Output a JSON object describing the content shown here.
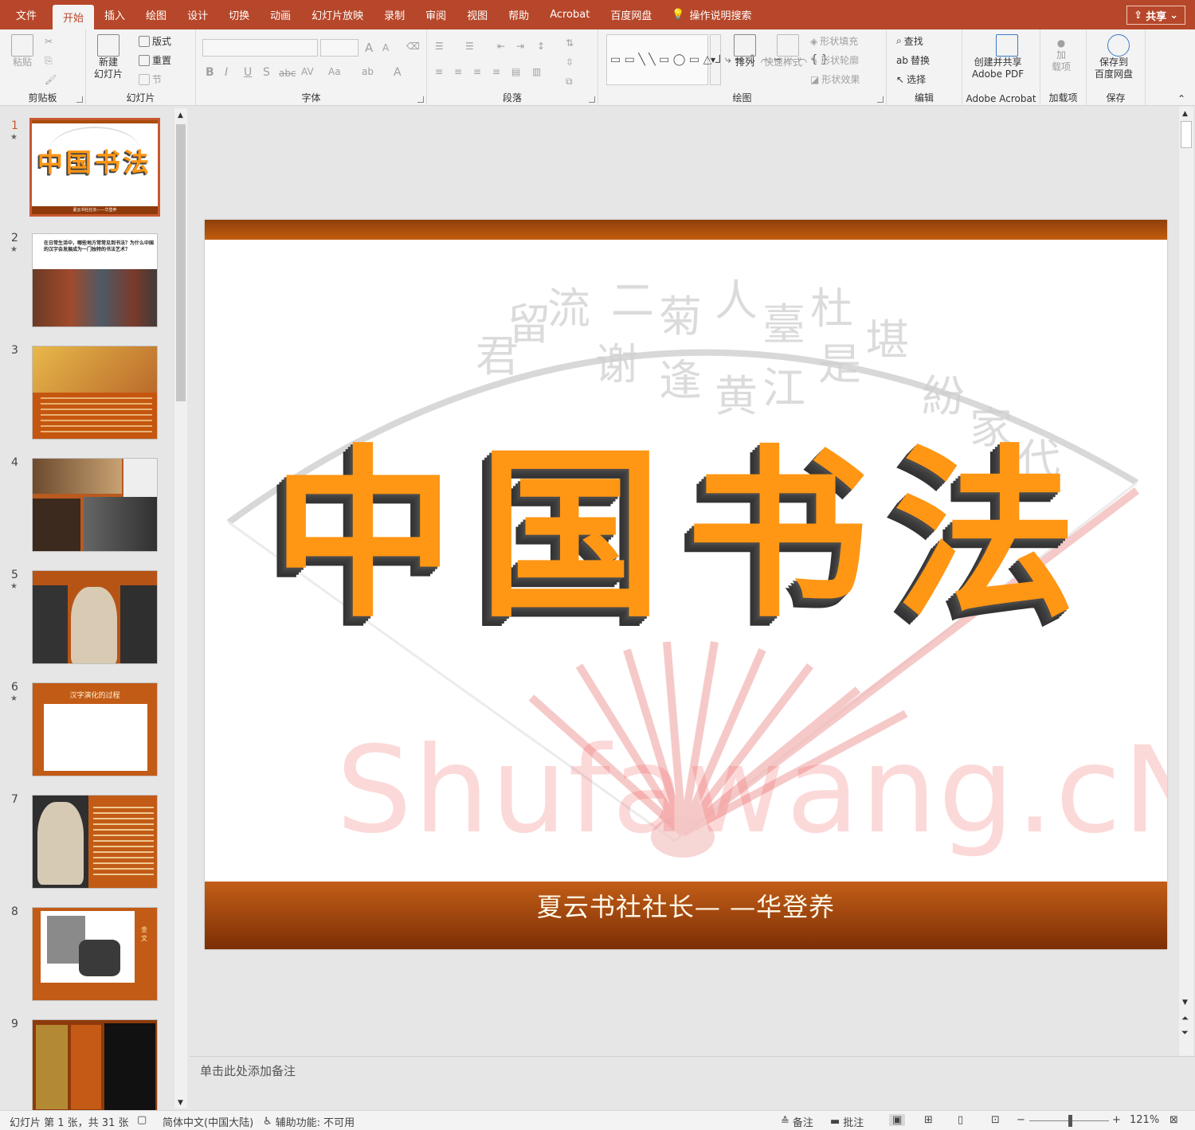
{
  "menu": {
    "tabs": [
      "文件",
      "开始",
      "插入",
      "绘图",
      "设计",
      "切换",
      "动画",
      "幻灯片放映",
      "录制",
      "审阅",
      "视图",
      "帮助",
      "Acrobat",
      "百度网盘"
    ],
    "active": "开始",
    "search": "操作说明搜索",
    "share": "共享"
  },
  "ribbon": {
    "clipboard": {
      "label": "剪贴板",
      "paste": "粘贴"
    },
    "slides": {
      "label": "幻灯片",
      "new_slide_1": "新建",
      "new_slide_2": "幻灯片",
      "layout": "版式",
      "reset": "重置",
      "section": "节"
    },
    "font": {
      "label": "字体",
      "bold": "B",
      "italic": "I",
      "underline": "U",
      "shadow": "S",
      "strike": "abc",
      "spacing": "AV",
      "case": "Aa",
      "grow": "A",
      "shrink": "A"
    },
    "paragraph": {
      "label": "段落"
    },
    "drawing": {
      "label": "绘图",
      "arrange": "排列",
      "quick_styles": "快速样式",
      "shape_fill": "形状填充",
      "shape_outline": "形状轮廓",
      "shape_effects": "形状效果"
    },
    "editing": {
      "label": "编辑",
      "find": "查找",
      "replace": "替换",
      "select": "选择"
    },
    "acrobat": {
      "label": "Adobe Acrobat",
      "create_1": "创建并共享",
      "create_2": "Adobe PDF"
    },
    "addins": {
      "label": "加载项",
      "btn_1": "加",
      "btn_2": "载项"
    },
    "save": {
      "label": "保存",
      "btn_1": "保存到",
      "btn_2": "百度网盘"
    }
  },
  "thumbnails": [
    {
      "num": "1",
      "star": true,
      "selected": true,
      "title": "中国书法",
      "subtitle": "夏云书社社长——华登养"
    },
    {
      "num": "2",
      "star": true,
      "caption": "在日常生活中，哪些地方常常见到书法？为什么中国的汉字会发展成为一门独特的书法艺术？"
    },
    {
      "num": "3",
      "star": false
    },
    {
      "num": "4",
      "star": false
    },
    {
      "num": "5",
      "star": true
    },
    {
      "num": "6",
      "star": true,
      "caption": "汉字演化的过程"
    },
    {
      "num": "7",
      "star": false
    },
    {
      "num": "8",
      "star": false,
      "caption": "金文"
    },
    {
      "num": "9",
      "star": false
    }
  ],
  "slide": {
    "title": "中国书法",
    "subtitle": "夏云书社社长— —华登养",
    "watermark": "Shufawang.cN"
  },
  "notes_placeholder": "单击此处添加备注",
  "status": {
    "slide_info": "幻灯片 第 1 张，共 31 张",
    "language": "简体中文(中国大陆)",
    "accessibility": "辅助功能: 不可用",
    "notes": "备注",
    "comments": "批注",
    "zoom": "121%"
  },
  "colors": {
    "brand": "#b7472a",
    "title_orange": "#ff9614",
    "band_dark": "#7c2e06"
  }
}
